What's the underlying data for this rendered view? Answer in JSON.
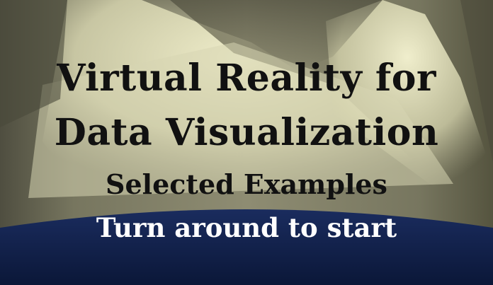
{
  "scene": {
    "title_line1": "Virtual Reality for",
    "title_line2": "Data Visualization",
    "subtitle": "Selected Examples",
    "prompt": "Turn around to start"
  },
  "colors": {
    "wall_dark": "#5e5d4c",
    "wall_light": "#d8d6b8",
    "spotlight": "#f2f0c8",
    "floor_navy": "#0f1f4a",
    "title_text": "#111111",
    "prompt_text": "#ffffff"
  }
}
